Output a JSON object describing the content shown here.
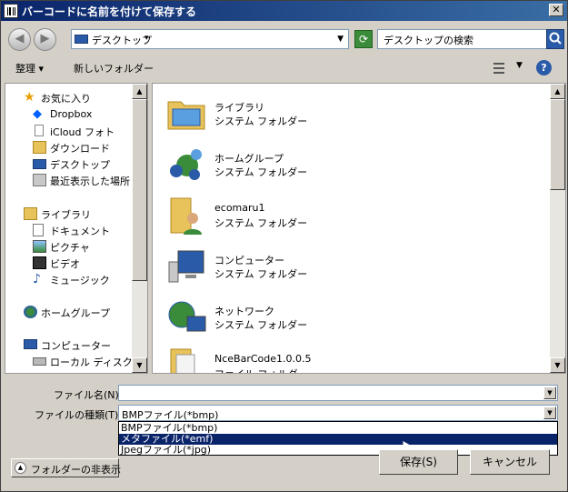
{
  "window": {
    "title": "バーコードに名前を付けて保存する"
  },
  "address": {
    "location": "デスクトップ",
    "search_placeholder": "デスクトップの検索"
  },
  "toolbar": {
    "organize": "整理 ▾",
    "new_folder": "新しいフォルダー"
  },
  "nav": {
    "favorites": [
      {
        "label": "お気に入り",
        "icon": "star-icon"
      },
      {
        "label": "Dropbox",
        "icon": "dropbox-icon"
      },
      {
        "label": "iCloud フォト",
        "icon": "icloud-icon"
      },
      {
        "label": "ダウンロード",
        "icon": "download-icon"
      },
      {
        "label": "デスクトップ",
        "icon": "desktop-icon"
      },
      {
        "label": "最近表示した場所",
        "icon": "recent-icon"
      }
    ],
    "libraries": [
      {
        "label": "ライブラリ",
        "icon": "library-icon"
      },
      {
        "label": "ドキュメント",
        "icon": "document-icon"
      },
      {
        "label": "ピクチャ",
        "icon": "picture-icon"
      },
      {
        "label": "ビデオ",
        "icon": "video-icon"
      },
      {
        "label": "ミュージック",
        "icon": "music-icon"
      }
    ],
    "homegroup": {
      "label": "ホームグループ",
      "icon": "homegroup-icon"
    },
    "computer": [
      {
        "label": "コンピューター",
        "icon": "computer-icon"
      },
      {
        "label": "ローカル ディスク (C",
        "icon": "disk-icon"
      }
    ]
  },
  "files": [
    {
      "name": "ライブラリ",
      "type": "システム フォルダー",
      "icon": "library-folder-icon"
    },
    {
      "name": "ホームグループ",
      "type": "システム フォルダー",
      "icon": "homegroup-icon"
    },
    {
      "name": "ecomaru1",
      "type": "システム フォルダー",
      "icon": "user-folder-icon"
    },
    {
      "name": "コンピューター",
      "type": "システム フォルダー",
      "icon": "computer-icon"
    },
    {
      "name": "ネットワーク",
      "type": "システム フォルダー",
      "icon": "network-icon"
    },
    {
      "name": "NceBarCode1.0.0.5",
      "type": "ファイル フォルダー",
      "icon": "folder-icon"
    }
  ],
  "form": {
    "filename_label": "ファイル名(N):",
    "filename_value": "",
    "filetype_label": "ファイルの種類(T):",
    "filetype_value": "BMPファイル(*bmp)",
    "filetype_options": [
      "BMPファイル(*bmp)",
      "メタファイル(*emf)",
      "Jpegファイル(*jpg)"
    ],
    "selected_option": "メタファイル(*emf)"
  },
  "buttons": {
    "save": "保存(S)",
    "cancel": "キャンセル",
    "hide_folders": "フォルダーの非表示"
  },
  "colors": {
    "selection": "#0a246a",
    "title_gradient_start": "#0a246a",
    "dialog_bg": "#d4d0c8"
  }
}
